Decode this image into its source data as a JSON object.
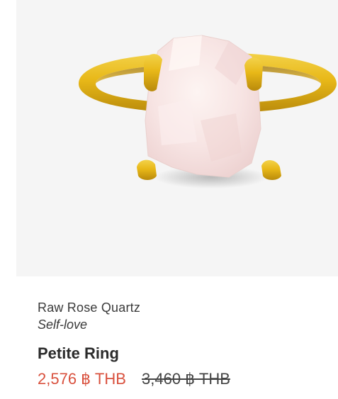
{
  "product": {
    "stone": "Raw Rose Quartz",
    "meaning": "Self-love",
    "name": "Petite Ring",
    "sale_price": "2,576 ฿ THB",
    "original_price": "3,460 ฿ THB"
  },
  "image": {
    "subject": "ring-icon",
    "background_color": "#f5f5f5",
    "metal_color": "#e8b818",
    "stone_color": "#f7e6e6"
  },
  "colors": {
    "sale_price": "#d9513e",
    "text": "#3a3a3a"
  }
}
